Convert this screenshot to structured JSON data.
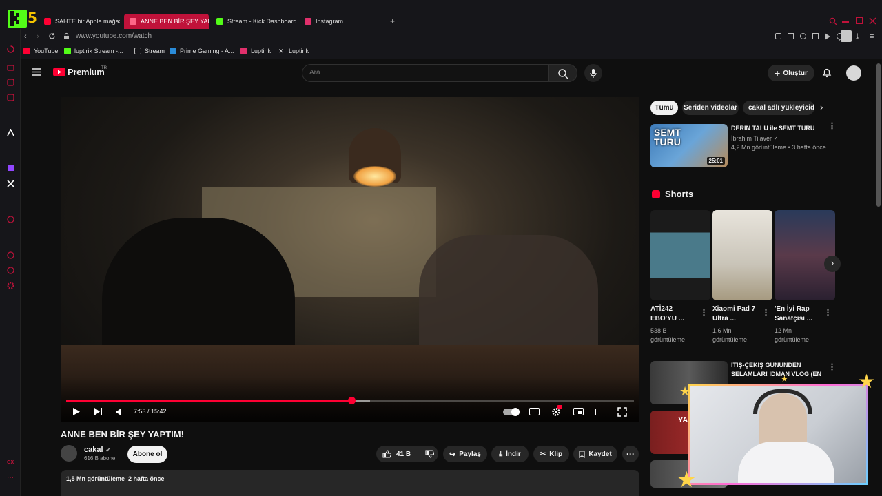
{
  "browser": {
    "logo_text": "5",
    "tabs": [
      {
        "label": "SAHTE bir Apple mağazası",
        "color": "#ff0033"
      },
      {
        "label": "ANNE BEN BİR ŞEY YAPTI",
        "color": "#ff0033"
      },
      {
        "label": "Stream - Kick Dashboard",
        "color": "#53fc18"
      },
      {
        "label": "Instagram",
        "color": "#e1306c"
      }
    ],
    "new_tab": "+",
    "url": "www.youtube.com/watch",
    "bookmarks": [
      {
        "label": "YouTube",
        "color": "#ff0033"
      },
      {
        "label": "luptirik Stream -...",
        "color": "#53fc18"
      },
      {
        "label": "Stream",
        "color": "#888888"
      },
      {
        "label": "Prime Gaming - A...",
        "color": "#2a8bd8"
      },
      {
        "label": "Luptirik",
        "color": "#e1306c"
      },
      {
        "label": "Luptirik",
        "color": "#dddddd"
      }
    ],
    "rail_footer": "GX"
  },
  "youtube": {
    "brand": "Premium",
    "region": "TR",
    "search_placeholder": "Ara",
    "create_label": "Oluştur",
    "video": {
      "title": "ANNE BEN BİR ŞEY YAPTIM!",
      "time": "7:53 / 15:42",
      "progress": 0.503,
      "buffered": 0.535,
      "channel": "cakal",
      "subs": "616 B abone",
      "subscribe": "Abone ol",
      "likes": "41 B",
      "share": "Paylaş",
      "download": "İndir",
      "clip": "Klip",
      "save": "Kaydet",
      "views_line": "1,5 Mn görüntüleme  2 hafta önce"
    },
    "chips": [
      "Tümü",
      "Seriden videolar",
      "cakal adlı yükleyiciden"
    ],
    "rec1": {
      "title": "DERİN TALU ile SEMT TURU",
      "channel": "İbrahim Tilaver",
      "meta": "4,2 Mn görüntüleme • 3 hafta önce",
      "duration": "25:01",
      "thumb_text": "SEMT TURU"
    },
    "shorts_title": "Shorts",
    "shorts": [
      {
        "title": "ATİ242 EBO'YU ...",
        "views": "538 B görüntüleme",
        "bg": "#4a7a8a"
      },
      {
        "title": "Xiaomi Pad 7 Ultra ...",
        "views": "1,6 Mn görüntüleme",
        "bg": "#c9c4b8"
      },
      {
        "title": "'En İyi Rap Sanatçısı ...",
        "views": "12 Mn görüntüleme",
        "bg": "#5a3a4a"
      }
    ],
    "rec2": {
      "title": "İTİŞ-ÇEKİŞ GÜNÜNDEN SELAMLAR! İDMAN VLOG (EN ..."
    },
    "rec3": {
      "thumb_text": "YA"
    }
  }
}
